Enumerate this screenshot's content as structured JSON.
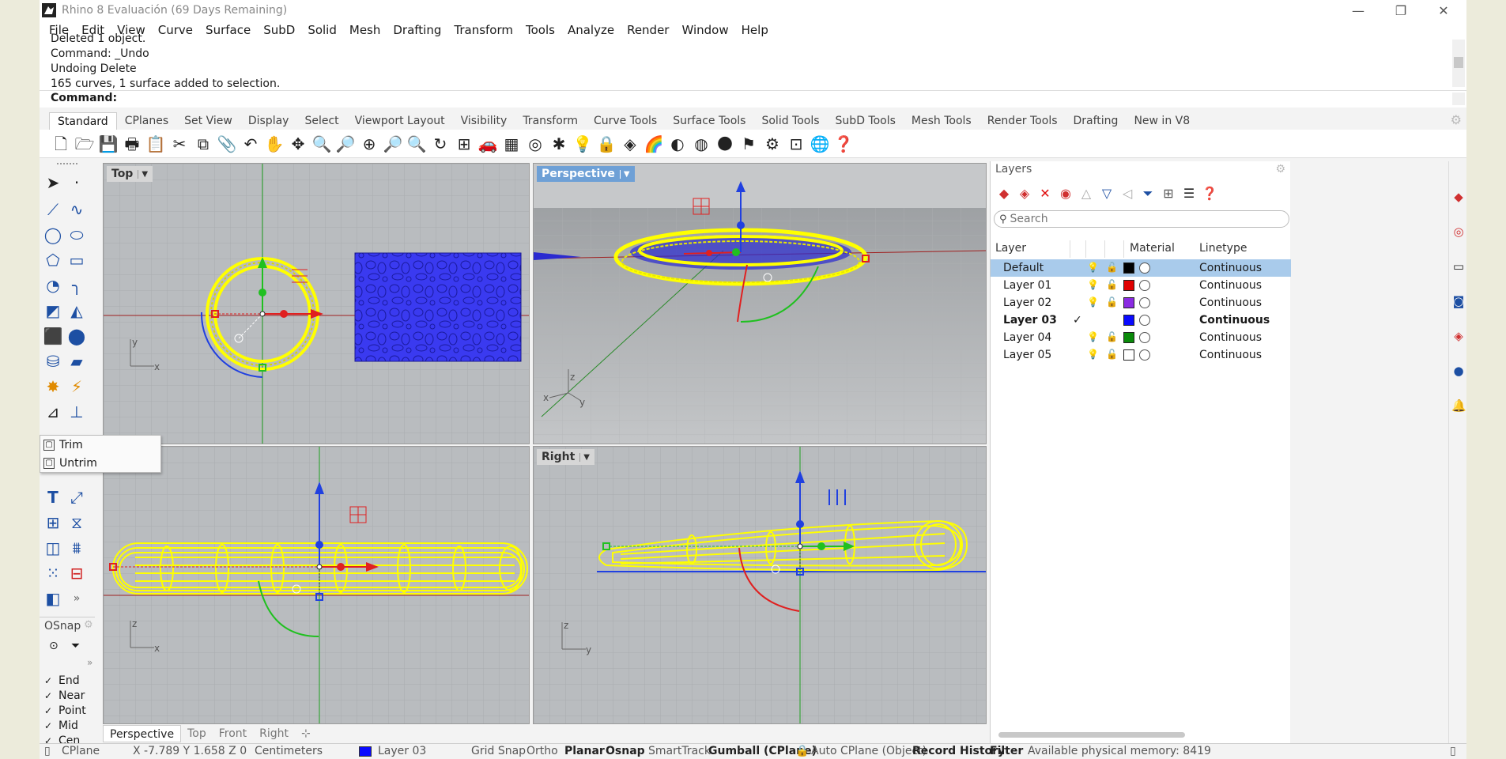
{
  "window": {
    "title": "Rhino 8 Evaluación (69 Days Remaining)",
    "minimize": "—",
    "restore": "❐",
    "close": "✕"
  },
  "menu": [
    "File",
    "Edit",
    "View",
    "Curve",
    "Surface",
    "SubD",
    "Solid",
    "Mesh",
    "Drafting",
    "Transform",
    "Tools",
    "Analyze",
    "Render",
    "Window",
    "Help"
  ],
  "command_history": {
    "lines": [
      "Deleted 1 object.",
      "Command: _Undo",
      "Undoing Delete",
      "165 curves, 1 surface added to selection."
    ],
    "prompt_label": "Command:"
  },
  "toolbar_tabs": [
    "Standard",
    "CPlanes",
    "Set View",
    "Display",
    "Select",
    "Viewport Layout",
    "Visibility",
    "Transform",
    "Curve Tools",
    "Surface Tools",
    "Solid Tools",
    "SubD Tools",
    "Mesh Tools",
    "Render Tools",
    "Drafting",
    "New in V8"
  ],
  "toolbar_icons": [
    "🗋",
    "🗁",
    "💾",
    "🖶",
    "📋",
    "✂",
    "⧉",
    "📎",
    "↶",
    "✋",
    "✥",
    "🔍",
    "🔎",
    "⊕",
    "🔎",
    "🔍",
    "↻",
    "⊞",
    "🚗",
    "▦",
    "◎",
    "✱",
    "💡",
    "🔒",
    "◈",
    "🌈",
    "◐",
    "◍",
    "🌑",
    "⚑",
    "⚙",
    "⊡",
    "🌐",
    "❓"
  ],
  "flyout": {
    "items": [
      "Trim",
      "Untrim"
    ]
  },
  "osnap": {
    "title": "OSnap",
    "options": [
      {
        "label": "End",
        "checked": true
      },
      {
        "label": "Near",
        "checked": true
      },
      {
        "label": "Point",
        "checked": true
      },
      {
        "label": "Mid",
        "checked": true
      },
      {
        "label": "Cen",
        "checked": true
      }
    ]
  },
  "viewports": {
    "top": {
      "label": "Top"
    },
    "perspective": {
      "label": "Perspective"
    },
    "front": {
      "label": ""
    },
    "right": {
      "label": "Right"
    }
  },
  "viewport_tabs": [
    "Perspective",
    "Top",
    "Front",
    "Right"
  ],
  "layers": {
    "title": "Layers",
    "search_placeholder": "Search",
    "columns": {
      "layer": "Layer",
      "material": "Material",
      "linetype": "Linetype"
    },
    "rows": [
      {
        "name": "Default",
        "current": false,
        "color": "#000000",
        "linetype": "Continuous",
        "bulb": "#1e64c8",
        "selected": true
      },
      {
        "name": "Layer 01",
        "current": false,
        "color": "#e00000",
        "linetype": "Continuous",
        "bulb": "#e0b000",
        "selected": false
      },
      {
        "name": "Layer 02",
        "current": false,
        "color": "#8a2be2",
        "linetype": "Continuous",
        "bulb": "#1e64c8",
        "selected": false
      },
      {
        "name": "Layer 03",
        "current": true,
        "color": "#0a0aff",
        "linetype": "Continuous",
        "bulb": "",
        "selected": false
      },
      {
        "name": "Layer 04",
        "current": false,
        "color": "#0a8a0a",
        "linetype": "Continuous",
        "bulb": "#e0b000",
        "selected": false
      },
      {
        "name": "Layer 05",
        "current": false,
        "color": "#ffffff",
        "linetype": "Continuous",
        "bulb": "#e0b000",
        "selected": false
      }
    ],
    "current_mark": "✓"
  },
  "statusbar": {
    "cplane": "CPlane",
    "coords": "X -7.789 Y 1.658 Z 0",
    "units": "Centimeters",
    "layer": "Layer 03",
    "layer_color": "#0a0aff",
    "grid_snap": "Grid Snap",
    "ortho": "Ortho",
    "planar": "Planar",
    "osnap": "Osnap",
    "smarttrack": "SmartTrack",
    "gumball": "Gumball (CPlane)",
    "auto_cplane": "Auto CPlane (Object)",
    "record_history": "Record History",
    "filter": "Filter",
    "memory": "Available physical memory: 8419"
  },
  "colors": {
    "viewport_bg": "#b9bcbf",
    "wireframe": "#ffff00",
    "selection_blue": "#3a3af0",
    "gumball_red": "#e02020",
    "gumball_green": "#20c020",
    "gumball_blue": "#2040e0"
  }
}
